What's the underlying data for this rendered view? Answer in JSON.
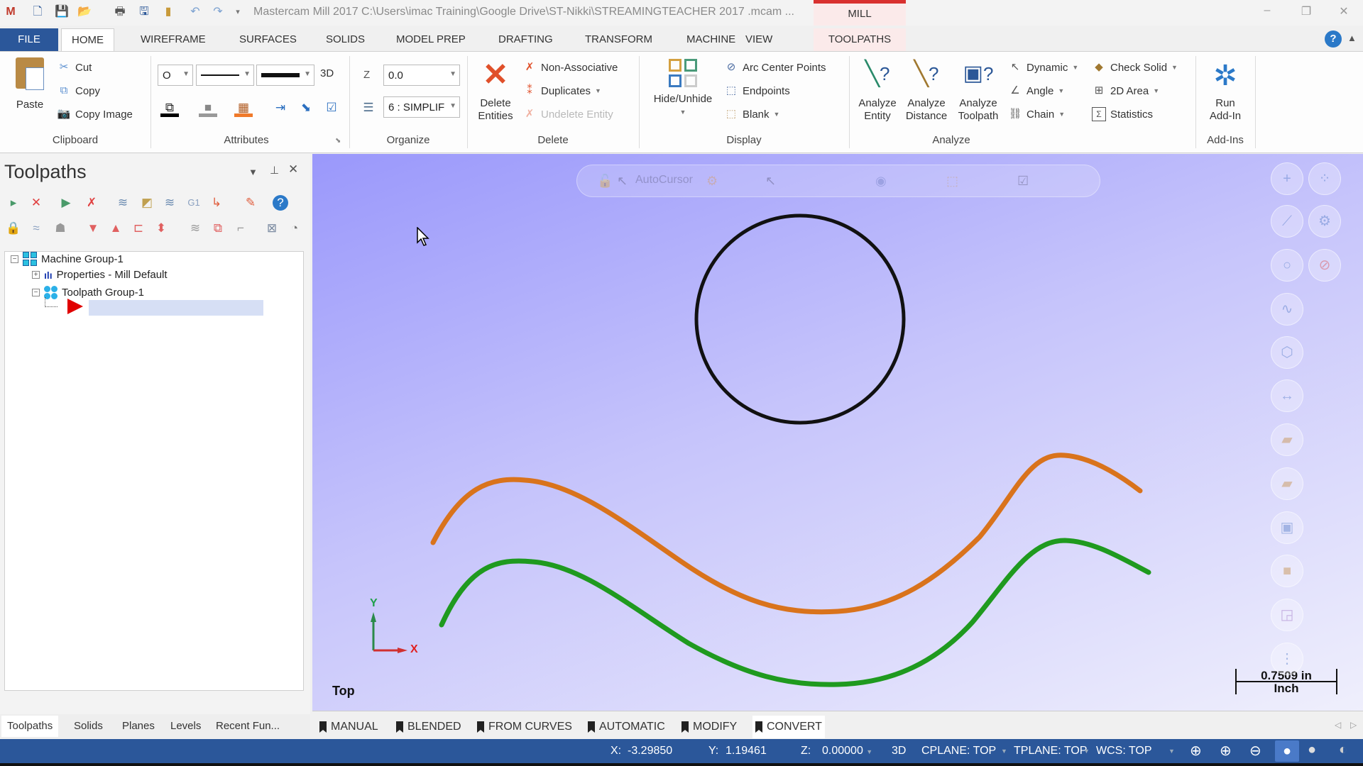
{
  "window": {
    "title": "Mastercam Mill 2017  C:\\Users\\imac Training\\Google Drive\\ST-Nikki\\STREAMINGTEACHER 2017 .mcam ...",
    "context_tab": "MILL",
    "minimize": "–",
    "restore": "❐",
    "close": "✕"
  },
  "ribbon_tabs": [
    "FILE",
    "HOME",
    "WIREFRAME",
    "SURFACES",
    "SOLIDS",
    "MODEL PREP",
    "DRAFTING",
    "TRANSFORM",
    "MACHINE",
    "VIEW",
    "TOOLPATHS"
  ],
  "active_tab": "HOME",
  "clipboard": {
    "paste": "Paste",
    "cut": "Cut",
    "copy": "Copy",
    "copy_image": "Copy Image",
    "label": "Clipboard"
  },
  "attributes": {
    "point_style": "O",
    "line_style": "",
    "line_width": "",
    "mode": "3D",
    "label": "Attributes"
  },
  "organize": {
    "z_label": "Z",
    "z_value": "0.0",
    "level": "6 : SIMPLIF",
    "label": "Organize"
  },
  "delete": {
    "delete_entities_1": "Delete",
    "delete_entities_2": "Entities",
    "non_associative": "Non-Associative",
    "duplicates": "Duplicates",
    "undelete": "Undelete Entity",
    "label": "Delete"
  },
  "display": {
    "hide_unhide": "Hide/Unhide",
    "arc_center": "Arc Center Points",
    "endpoints": "Endpoints",
    "blank": "Blank",
    "label": "Display"
  },
  "analyze": {
    "entity_1": "Analyze",
    "entity_2": "Entity",
    "distance_1": "Analyze",
    "distance_2": "Distance",
    "toolpath_1": "Analyze",
    "toolpath_2": "Toolpath",
    "dynamic": "Dynamic",
    "angle": "Angle",
    "chain": "Chain",
    "check_solid": "Check Solid",
    "area_2d": "2D Area",
    "statistics": "Statistics",
    "label": "Analyze"
  },
  "addins": {
    "run_1": "Run",
    "run_2": "Add-In",
    "label": "Add-Ins"
  },
  "panel": {
    "title": "Toolpaths",
    "tree": [
      {
        "label": "Machine Group-1",
        "icon": "machine-group-icon"
      },
      {
        "label": "Properties - Mill Default",
        "icon": "properties-icon"
      },
      {
        "label": "Toolpath Group-1",
        "icon": "toolpath-group-icon"
      }
    ],
    "bottom_tabs": [
      "Toolpaths",
      "Solids",
      "Planes",
      "Levels",
      "Recent Fun..."
    ]
  },
  "viewport": {
    "autocursor": "AutoCursor",
    "view_name": "Top",
    "axis_x": "X",
    "axis_y": "Y",
    "scale_value": "0.7509 in",
    "scale_unit": "Inch",
    "colors": {
      "circle": "#111111",
      "upper_curve": "#d9731c",
      "lower_curve": "#1f9a1f",
      "background_start": "#9a98fb",
      "background_end": "#efeffc"
    }
  },
  "gview_tabs": [
    "MANUAL",
    "BLENDED",
    "FROM CURVES",
    "AUTOMATIC",
    "MODIFY",
    "CONVERT"
  ],
  "active_gview_tab": "CONVERT",
  "status": {
    "x_label": "X:",
    "x": "-3.29850",
    "y_label": "Y:",
    "y": "1.19461",
    "z_label": "Z:",
    "z": "0.00000",
    "mode": "3D",
    "cplane": "CPLANE: TOP",
    "tplane": "TPLANE: TOP",
    "wcs": "WCS: TOP"
  },
  "colors": {
    "accent": "#2b579a",
    "context_tab_red": "#d9302f"
  }
}
